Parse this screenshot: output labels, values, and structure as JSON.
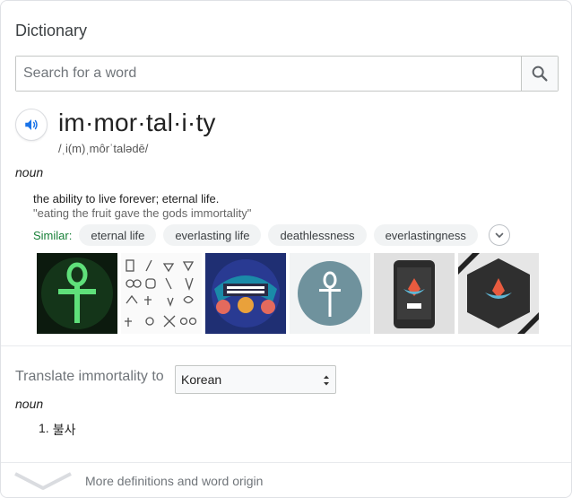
{
  "panel": {
    "title": "Dictionary"
  },
  "search": {
    "placeholder": "Search for a word",
    "value": ""
  },
  "entry": {
    "word": "im·mor·tal·i·ty",
    "phonetic": "/ˌi(m)ˌmôrˈtalədē/",
    "part_of_speech": "noun",
    "definition": "the ability to live forever; eternal life.",
    "example": "\"eating the fruit gave the gods immortality\"",
    "similar_label": "Similar:",
    "similar": [
      "eternal life",
      "everlasting life",
      "deathlessness",
      "everlastingness"
    ]
  },
  "images": [
    {
      "name": "green-ankh"
    },
    {
      "name": "doodle-icons"
    },
    {
      "name": "immortal-banner"
    },
    {
      "name": "ankh-circle"
    },
    {
      "name": "phone-lotus"
    },
    {
      "name": "hexagon-lotus"
    }
  ],
  "translate": {
    "label": "Translate immortality to",
    "language": "Korean",
    "part_of_speech": "noun",
    "items": [
      {
        "number": "1.",
        "text": "불사"
      }
    ]
  },
  "footer": {
    "more_label": "More definitions and word origin"
  },
  "colors": {
    "similar_label": "#188038",
    "speaker_icon": "#1a73e8",
    "chip_bg": "#f1f3f4"
  }
}
